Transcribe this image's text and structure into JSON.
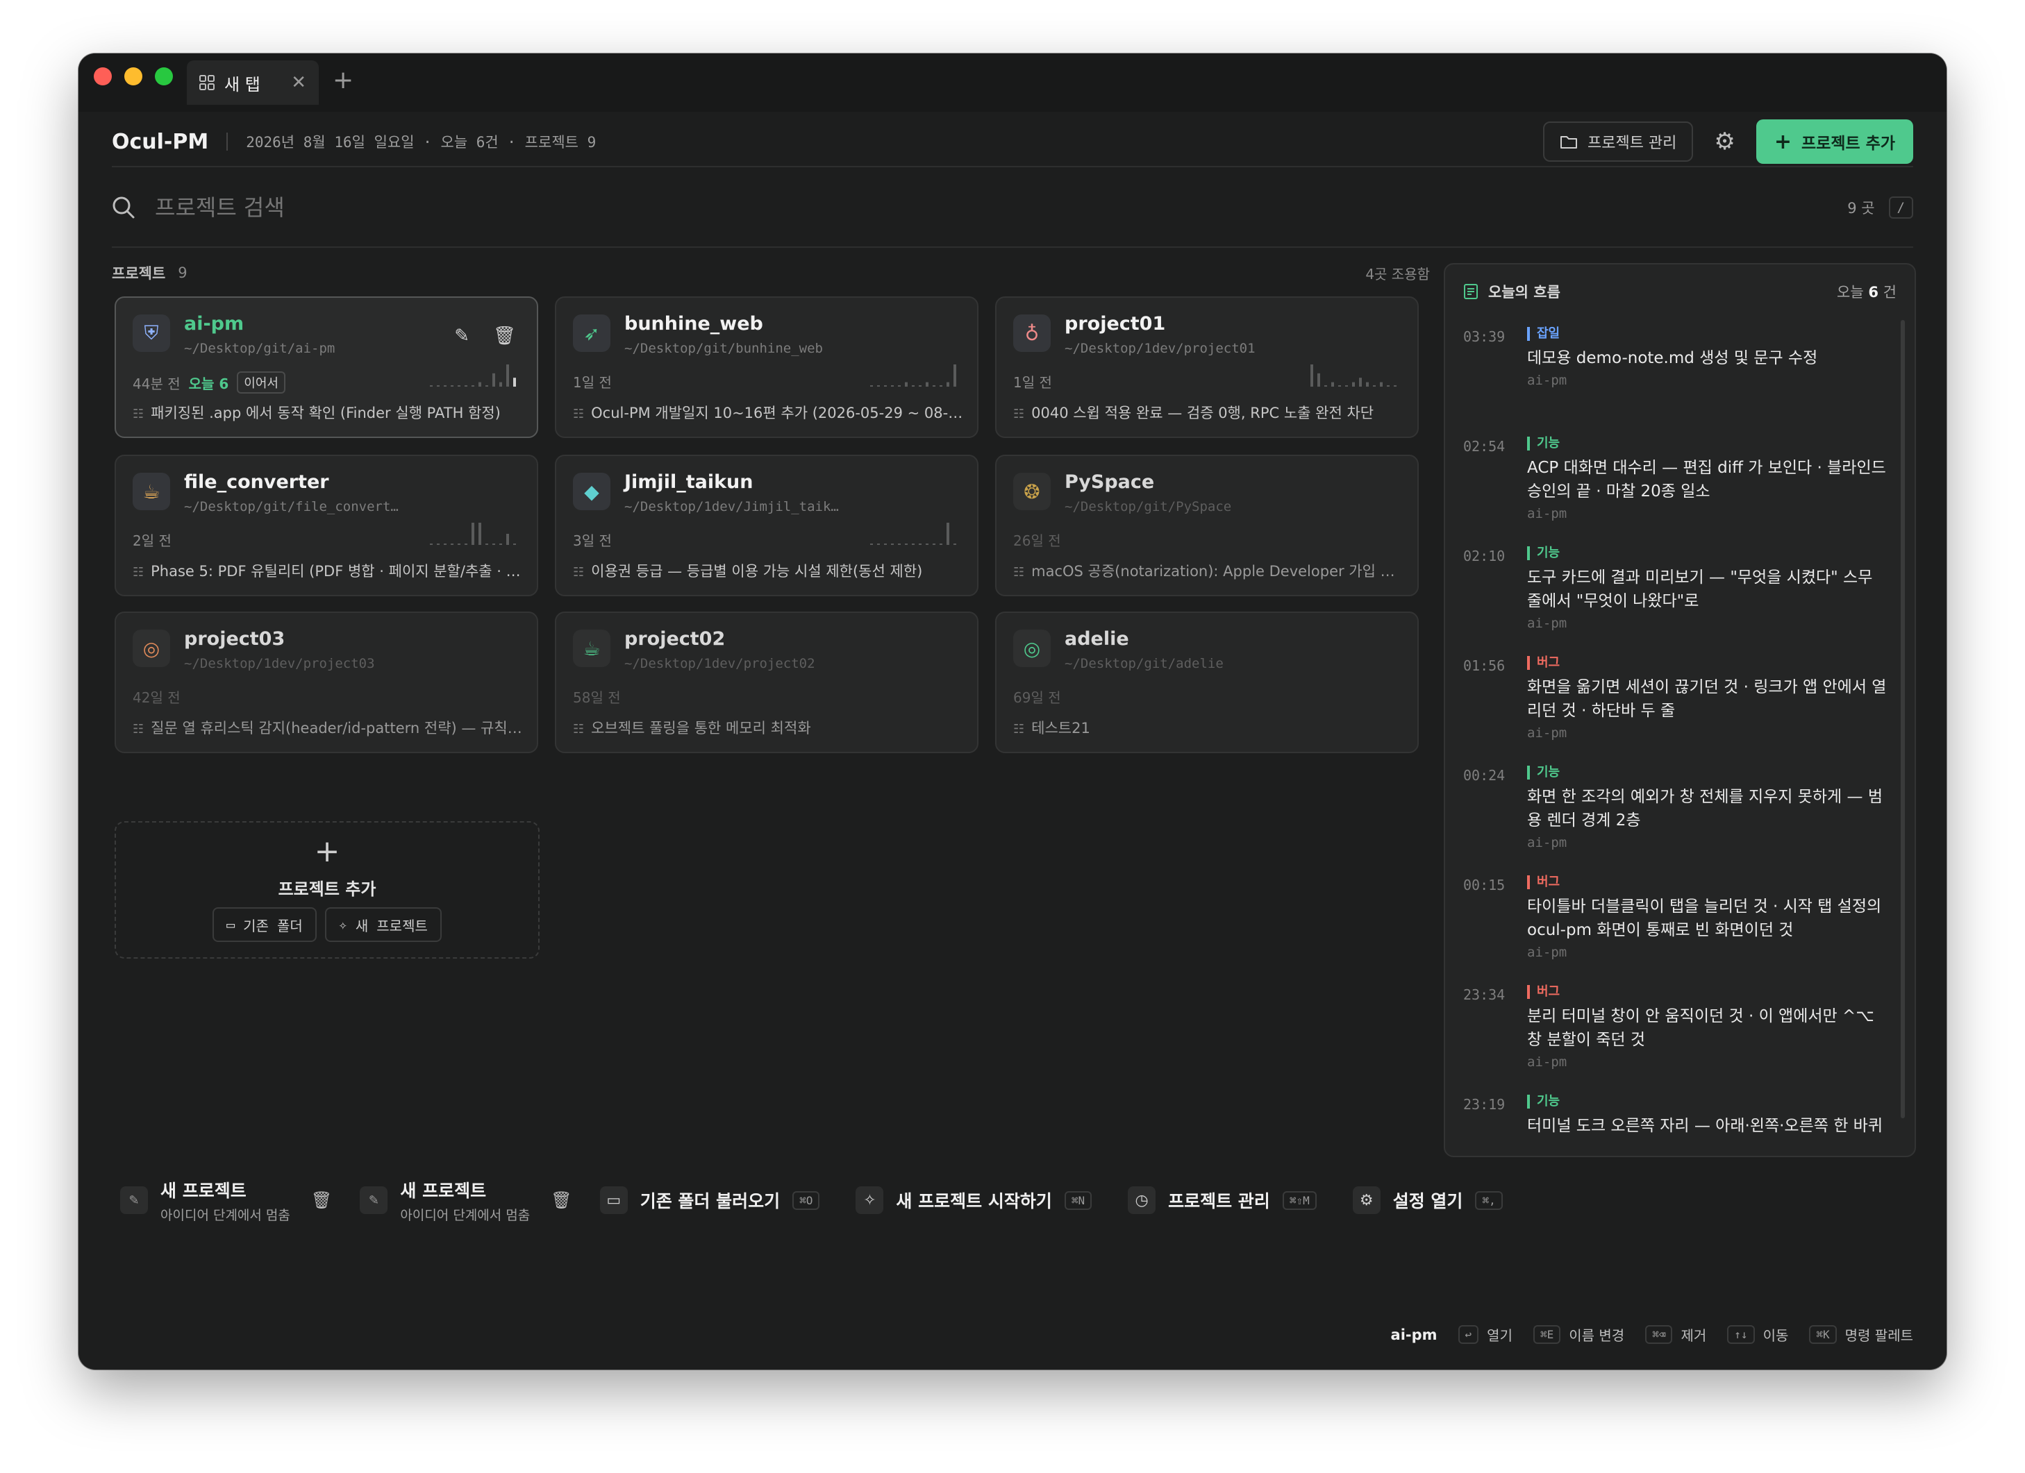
{
  "window": {
    "tab_label": "새 탭",
    "tab_close": "✕",
    "new_tab": "+"
  },
  "header": {
    "app_name": "Ocul-PM",
    "meta": "2026년 8월 16일 일요일 · 오늘 6건 · 프로젝트 9",
    "manage_label": "프로젝트 관리",
    "add_label": "프로젝트 추가"
  },
  "search": {
    "placeholder": "프로젝트 검색",
    "count": "9 곳",
    "shortcut": "/"
  },
  "projects_section": {
    "title": "프로젝트",
    "count": "9",
    "sort_label": "4곳 조용함"
  },
  "projects": [
    {
      "name": "ai-pm",
      "path": "~/Desktop/git/ai-pm",
      "when": "44분 전",
      "today": "오늘 6",
      "resume": "이어서",
      "last": "패키징된 .app 에서 동작 확인 (Finder 실행 PATH 함정)",
      "icon": "shield-icon",
      "icon_glyph": "⛨",
      "icon_color": "#8fb3ff",
      "active": true,
      "spark": [
        0,
        0,
        0,
        0,
        0,
        0,
        0,
        1,
        0,
        3,
        1,
        5,
        2
      ]
    },
    {
      "name": "bunhine_web",
      "path": "~/Desktop/git/bunhine_web",
      "when": "1일 전",
      "today": "",
      "resume": "",
      "last": "Ocul-PM 개발일지 10~16편 추가 (2026-05-29 ~ 08-12...",
      "icon": "rocket-icon",
      "icon_glyph": "➶",
      "icon_color": "#4fc98d",
      "active": false,
      "spark": [
        0,
        0,
        0,
        0,
        0,
        1,
        0,
        0,
        1,
        0,
        0,
        1,
        5
      ]
    },
    {
      "name": "project01",
      "path": "~/Desktop/1dev/project01",
      "when": "1일 전",
      "today": "",
      "resume": "",
      "last": "0040 스윕 적용 완료 — 검증 0행, RPC 노출 완전 차단",
      "icon": "bulb-icon",
      "icon_glyph": "♁",
      "icon_color": "#ef8a8a",
      "active": false,
      "spark": [
        5,
        3,
        0,
        1,
        0,
        0,
        1,
        2,
        1,
        0,
        1,
        0,
        0
      ]
    },
    {
      "name": "file_converter",
      "path": "~/Desktop/git/file_convert…",
      "when": "2일 전",
      "today": "",
      "resume": "",
      "last": "Phase 5: PDF 유틸리티 (PDF 병합 · 페이지 분할/추출 · PD...",
      "icon": "cup-icon",
      "icon_glyph": "☕",
      "icon_color": "#f0b35a",
      "active": false,
      "spark": [
        0,
        0,
        0,
        0,
        0,
        0,
        4,
        4,
        0,
        0,
        0,
        2,
        0
      ]
    },
    {
      "name": "Jimjil_taikun",
      "path": "~/Desktop/1dev/Jimjil_taik…",
      "when": "3일 전",
      "today": "",
      "resume": "",
      "last": "이용권 등급 — 등급별 이용 가능 시설 제한(동선 제한)",
      "icon": "gem-icon",
      "icon_glyph": "◆",
      "icon_color": "#5fd0d0",
      "active": false,
      "spark": [
        0,
        0,
        0,
        0,
        0,
        0,
        0,
        0,
        0,
        0,
        0,
        4,
        0
      ]
    },
    {
      "name": "PySpace",
      "path": "~/Desktop/git/PySpace",
      "when": "26일 전",
      "today": "",
      "resume": "",
      "last": "macOS 공증(notarization): Apple Developer 가입 → C",
      "icon": "fish-icon",
      "icon_glyph": "❂",
      "icon_color": "#c9a24a",
      "active": false,
      "dim": true,
      "spark": []
    },
    {
      "name": "project03",
      "path": "~/Desktop/1dev/project03",
      "when": "42일 전",
      "today": "",
      "resume": "",
      "last": "질문 열 휴리스틱 감지(header/id-pattern 전략) — 규칙\\u2193",
      "icon": "target-icon",
      "icon_glyph": "◎",
      "icon_color": "#e08a5a",
      "active": false,
      "dim": true,
      "spark": []
    },
    {
      "name": "project02",
      "path": "~/Desktop/1dev/project02",
      "when": "58일 전",
      "today": "",
      "resume": "",
      "last": "오브젝트 풀링을 통한 메모리 최적화",
      "icon": "cup-icon",
      "icon_glyph": "☕",
      "icon_color": "#4fc98d",
      "active": false,
      "dim": true,
      "spark": []
    },
    {
      "name": "adelie",
      "path": "~/Desktop/git/adelie",
      "when": "69일 전",
      "today": "",
      "resume": "",
      "last": "테스트21",
      "icon": "target-icon",
      "icon_glyph": "◎",
      "icon_color": "#4fc98d",
      "active": false,
      "dim": true,
      "spark": []
    }
  ],
  "add_card": {
    "plus": "+",
    "label": "프로젝트 추가",
    "existing_label": "기존 폴더",
    "new_label": "새 프로젝트"
  },
  "flow": {
    "title": "오늘의 흐름",
    "count_prefix": "오늘",
    "count_value": "6",
    "count_suffix": "건",
    "items": [
      {
        "time": "03:39",
        "tag": "잡일",
        "kind": "misc",
        "title": "데모용 demo-note.md 생성 및 문구 수정",
        "project": "ai-pm",
        "lines": 1
      },
      {
        "time": "02:54",
        "tag": "기능",
        "kind": "feat",
        "title": "ACP 대화면 대수리 — 편집 diff 가 보인다 · 블라인드 승인의 끝 · 마찰 20종 일소",
        "project": "ai-pm",
        "lines": 2
      },
      {
        "time": "02:10",
        "tag": "기능",
        "kind": "feat",
        "title": "도구 카드에 결과 미리보기 — \"무엇을 시켰다\" 스무 줄에서 \"무엇이 나왔다\"로",
        "project": "ai-pm",
        "lines": 2
      },
      {
        "time": "01:56",
        "tag": "버그",
        "kind": "bug",
        "title": "화면을 옮기면 세션이 끊기던 것 · 링크가 앱 안에서 열리던 것 · 하단바 두 줄",
        "project": "ai-pm",
        "lines": 2
      },
      {
        "time": "00:24",
        "tag": "기능",
        "kind": "feat",
        "title": "화면 한 조각의 예외가 창 전체를 지우지 못하게 — 범용 렌더 경계 2층",
        "project": "ai-pm",
        "lines": 2
      },
      {
        "time": "00:15",
        "tag": "버그",
        "kind": "bug",
        "title": "타이틀바 더블클릭이 탭을 늘리던 것 · 시작 탭 설정의 ocul-pm 화면이 통째로 빈 화면이던 것",
        "project": "ai-pm",
        "lines": 2
      },
      {
        "time": "23:34",
        "tag": "버그",
        "kind": "bug",
        "title": "분리 터미널 창이 안 움직이던 것 · 이 앱에서만 ^⌥ 창 분할이 죽던 것",
        "project": "ai-pm",
        "lines": 2
      },
      {
        "time": "23:19",
        "tag": "기능",
        "kind": "feat",
        "title": "터미널 도크 오른쪽 자리 — 아래·왼쪽·오른쪽 한 바퀴",
        "project": "",
        "lines": 2
      }
    ]
  },
  "recent": [
    {
      "title": "새 프로젝트",
      "sub": "아이디어 단계에서 멈춤"
    },
    {
      "title": "새 프로젝트",
      "sub": "아이디어 단계에서 멈춤"
    }
  ],
  "quick_actions": [
    {
      "label": "기존 폴더 불러오기",
      "kbd": "⌘O",
      "icon": "folder-icon",
      "glyph": "▭"
    },
    {
      "label": "새 프로젝트 시작하기",
      "kbd": "⌘N",
      "icon": "sparkle-icon",
      "glyph": "✧"
    },
    {
      "label": "프로젝트 관리",
      "kbd": "⌘⇧M",
      "icon": "clock-icon",
      "glyph": "◷"
    },
    {
      "label": "설정 열기",
      "kbd": "⌘,",
      "icon": "gear-icon",
      "glyph": "⚙"
    }
  ],
  "footer": {
    "current": "ai-pm",
    "hints": [
      {
        "kbd": "↩",
        "label": "열기"
      },
      {
        "kbd": "⌘E",
        "label": "이름 변경"
      },
      {
        "kbd": "⌘⌫",
        "label": "제거"
      },
      {
        "kbd": "↑↓",
        "label": "이동"
      },
      {
        "kbd": "⌘K",
        "label": "명령 팔레트"
      }
    ]
  },
  "colors": {
    "accent": "#4fc98d",
    "bug": "#ef6b60",
    "misc": "#6aa3ff",
    "background": "#1d1e1e"
  }
}
